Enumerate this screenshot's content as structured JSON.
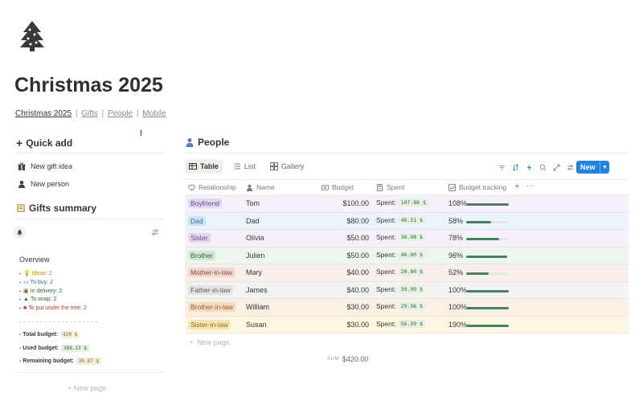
{
  "page": {
    "title": "Christmas 2025",
    "breadcrumb": {
      "current": "Christmas 2025",
      "sep": "|",
      "links": [
        "Gifts",
        "People",
        "Mobile"
      ]
    }
  },
  "quick_add": {
    "heading": "Quick add",
    "buttons": [
      {
        "label": "New gift idea",
        "icon": "gift-icon"
      },
      {
        "label": "New person",
        "icon": "person-icon"
      }
    ]
  },
  "gifts_summary": {
    "heading": "Gifts summary",
    "overview": {
      "title": "Overview",
      "items": [
        {
          "label": "Ideas: 2",
          "icon": "lightbulb-icon",
          "color": "#c28a14"
        },
        {
          "label": "To buy: 2",
          "icon": "card-icon",
          "color": "#2b6cb0"
        },
        {
          "label": "In delivery: 2",
          "icon": "box-icon",
          "color": "#2e6b30"
        },
        {
          "label": "To wrap: 2",
          "icon": "tree-icon",
          "color": "#2e6b30"
        },
        {
          "label": "To put under the tree: 2",
          "icon": "gift-icon",
          "color": "#c0392b"
        }
      ],
      "dashes": "- - - - - - - - - - - - - - - - - - -",
      "total_label": "- Total budget:",
      "total_value": "420 $",
      "used_label": "- Used budget:",
      "used_value": "389.13 $",
      "remaining_label": "- Remaining budget:",
      "remaining_value": "30.87 $"
    },
    "new_page": "New page"
  },
  "people": {
    "heading": "People",
    "tabs": [
      {
        "label": "Table",
        "icon": "table-icon",
        "active": true
      },
      {
        "label": "List",
        "icon": "list-icon",
        "active": false
      },
      {
        "label": "Gallery",
        "icon": "gallery-icon",
        "active": false
      }
    ],
    "new_button": "New",
    "columns": [
      "Relationship",
      "Name",
      "Budget",
      "Spent",
      "Budget tracking"
    ],
    "rows": [
      {
        "relationship": "Boyfriend",
        "name": "Tom",
        "budget": "$100.00",
        "spent_label": "Spent:",
        "spent": "107.88 $",
        "tracking": "108%",
        "fill": 1.0,
        "row_bg": "#f6f0fb",
        "tag_bg": "#e2d6f0",
        "tag_color": "#6b4a99"
      },
      {
        "relationship": "Dad",
        "name": "Dad",
        "budget": "$80.00",
        "spent_label": "Spent:",
        "spent": "46.51 $",
        "tracking": "58%",
        "fill": 0.58,
        "row_bg": "#ecf4fb",
        "tag_bg": "#cfe2f5",
        "tag_color": "#2b6cb0"
      },
      {
        "relationship": "Sister",
        "name": "Olivia",
        "budget": "$50.00",
        "spent_label": "Spent:",
        "spent": "38.98 $",
        "tracking": "78%",
        "fill": 0.78,
        "row_bg": "#f6f0fb",
        "tag_bg": "#e2d6f0",
        "tag_color": "#6b4a99"
      },
      {
        "relationship": "Brother",
        "name": "Julien",
        "budget": "$50.00",
        "spent_label": "Spent:",
        "spent": "48.00 $",
        "tracking": "96%",
        "fill": 0.96,
        "row_bg": "#edf5ef",
        "tag_bg": "#d3e7d7",
        "tag_color": "#2e6b30"
      },
      {
        "relationship": "Mother-in-law",
        "name": "Mary",
        "budget": "$40.00",
        "spent_label": "Spent:",
        "spent": "20.80 $",
        "tracking": "52%",
        "fill": 0.52,
        "row_bg": "#f8eeea",
        "tag_bg": "#efd8cf",
        "tag_color": "#8a4b35"
      },
      {
        "relationship": "Father-in-law",
        "name": "James",
        "budget": "$40.00",
        "spent_label": "Spent:",
        "spent": "39.99 $",
        "tracking": "100%",
        "fill": 1.0,
        "row_bg": "#f3f3f2",
        "tag_bg": "#e3e3e1",
        "tag_color": "#5f5e5b"
      },
      {
        "relationship": "Brother-in-law",
        "name": "William",
        "budget": "$30.00",
        "spent_label": "Spent:",
        "spent": "29.96 $",
        "tracking": "100%",
        "fill": 1.0,
        "row_bg": "#fbf0e4",
        "tag_bg": "#f4dcc0",
        "tag_color": "#9a5a1c"
      },
      {
        "relationship": "Sister-in-law",
        "name": "Susan",
        "budget": "$30.00",
        "spent_label": "Spent:",
        "spent": "56.99 $",
        "tracking": "190%",
        "fill": 1.0,
        "row_bg": "#fcf6e3",
        "tag_bg": "#f5e6b5",
        "tag_color": "#8b6d1b"
      }
    ],
    "new_page": "New page",
    "sum_label": "SUM",
    "sum_value": "$420.00"
  },
  "colors": {
    "accent": "#2383e2",
    "progress": "#448361"
  }
}
